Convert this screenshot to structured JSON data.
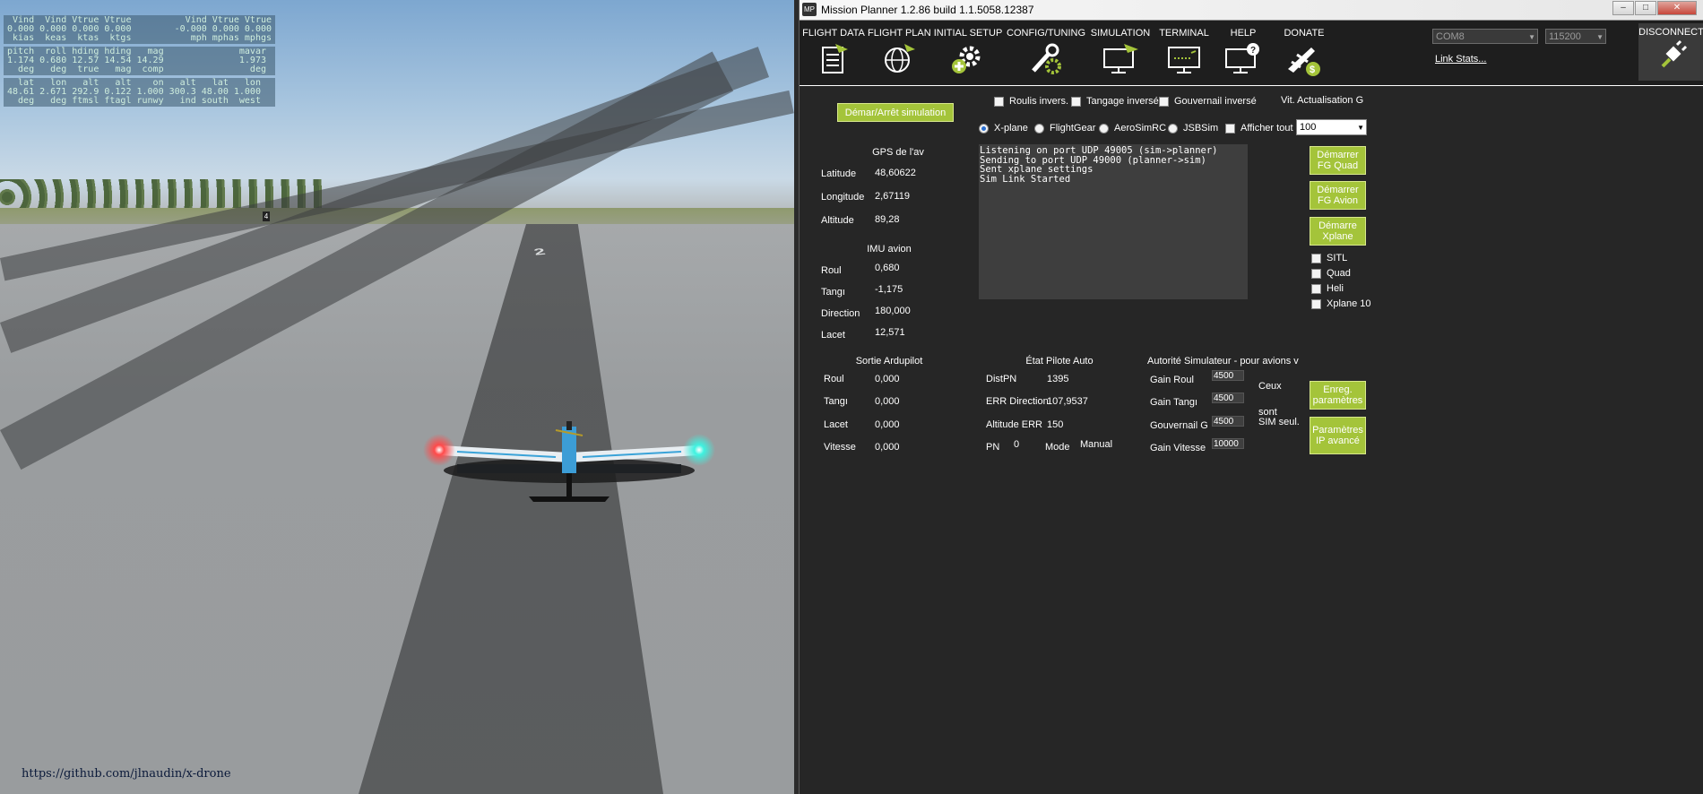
{
  "xplane": {
    "hud": {
      "speed_header": " Vind  Vind Vtrue Vtrue          Vind Vtrue Vtrue",
      "speed_values": "0.000 0.000 0.000 0.000        -0.000 0.000 0.000",
      "speed_units": " kias  keas  ktas  ktgs           mph mphas mphgs",
      "att_header": "pitch  roll hding hding   mag              mavar",
      "att_values": "1.174 0.680 12.57 14.54 14.29              1.973",
      "att_units": "  deg   deg  true   mag  comp                deg",
      "pos_header": "  lat   lon   alt   alt    on   alt   lat   lon",
      "pos_values": "48.61 2.671 292.9 0.122 1.000 300.3 48.00 1.000",
      "pos_units": "  deg   deg ftmsl ftagl runwy   ind south  west"
    },
    "runway_number": "2",
    "github_url": "https://github.com/jlnaudin/x-drone"
  },
  "window": {
    "title": "Mission Planner 1.2.86 build 1.1.5058.12387",
    "icon_text": "MP"
  },
  "menu": {
    "items": [
      {
        "label": "FLIGHT DATA",
        "icon": "flight-data-icon"
      },
      {
        "label": "FLIGHT PLAN",
        "icon": "flight-plan-icon"
      },
      {
        "label": "INITIAL SETUP",
        "icon": "initial-setup-icon"
      },
      {
        "label": "CONFIG/TUNING",
        "icon": "config-tuning-icon"
      },
      {
        "label": "SIMULATION",
        "icon": "simulation-icon"
      },
      {
        "label": "TERMINAL",
        "icon": "terminal-icon"
      },
      {
        "label": "HELP",
        "icon": "help-icon"
      },
      {
        "label": "DONATE",
        "icon": "donate-icon"
      }
    ],
    "com_port": "COM8",
    "baud_rate": "115200",
    "link_stats": "Link Stats...",
    "disconnect": "DISCONNECT"
  },
  "sim": {
    "start_stop_button": "Démar/Arrêt simulation",
    "roll_invert_label": "Roulis invers.",
    "pitch_invert_label": "Tangage inversé",
    "rudder_invert_label": "Gouvernail inversé",
    "update_rate_label": "Vit. Actualisation G",
    "update_rate_value": "100",
    "sim_options": [
      "X-plane",
      "FlightGear",
      "AeroSimRC",
      "JSBSim"
    ],
    "selected_sim": "X-plane",
    "show_all_label": "Afficher tout",
    "gps": {
      "title": "GPS de l'av",
      "lat_label": "Latitude",
      "lat": "48,60622",
      "lon_label": "Longitude",
      "lon": "2,67119",
      "alt_label": "Altitude",
      "alt": "89,28"
    },
    "imu": {
      "title": "IMU avion",
      "roll_label": "Roul",
      "roll": "0,680",
      "pitch_label": "Tangı",
      "pitch": "-1,175",
      "heading_label": "Direction",
      "heading": "180,000",
      "yaw_label": "Lacet",
      "yaw": "12,571"
    },
    "console_lines": [
      "Listening on port UDP 49005 (sim->planner)",
      "Sending to port UDP 49000 (planner->sim)",
      "Sent xplane settings",
      "Sim Link Started"
    ],
    "buttons": {
      "fg_quad": "Démarrer FG Quad",
      "fg_avion": "Démarrer FG Avion",
      "xplane": "Démarre Xplane",
      "save_params": "Enreg. paramètres",
      "advanced_params": "Paramètres IP avancé"
    },
    "vehicle_checks": [
      "SITL",
      "Quad",
      "Heli",
      "Xplane 10"
    ],
    "ardupilot_out": {
      "title": "Sortie Ardupilot",
      "roll_label": "Roul",
      "roll": "0,000",
      "pitch_label": "Tangı",
      "pitch": "0,000",
      "yaw_label": "Lacet",
      "yaw": "0,000",
      "speed_label": "Vitesse",
      "speed": "0,000"
    },
    "autopilot": {
      "title": "État Pilote Auto",
      "dist_label": "DistPN",
      "dist": "1395",
      "err_dir_label": "ERR Direction",
      "err_dir": "107,9537",
      "alt_err_label": "Altitude ERR",
      "alt_err": "150",
      "wp_label": "PN",
      "wp": "0",
      "mode_label": "Mode",
      "mode": "Manual"
    },
    "authority": {
      "title": "Autorité Simulateur - pour avions v",
      "roll_gain_label": "Gain Roul",
      "roll_gain": "4500",
      "pitch_gain_label": "Gain Tangı",
      "pitch_gain": "4500",
      "rudder_gain_label": "Gouvernail G",
      "rudder_gain": "4500",
      "speed_gain_label": "Gain Vitesse",
      "speed_gain": "10000",
      "note_line1": "Ceux",
      "note_line2": "sont",
      "note_line3": "SIM seul."
    }
  },
  "colors": {
    "accent_green": "#a4c43a",
    "panel_bg": "#262626",
    "console_bg": "#3e3e3e"
  }
}
